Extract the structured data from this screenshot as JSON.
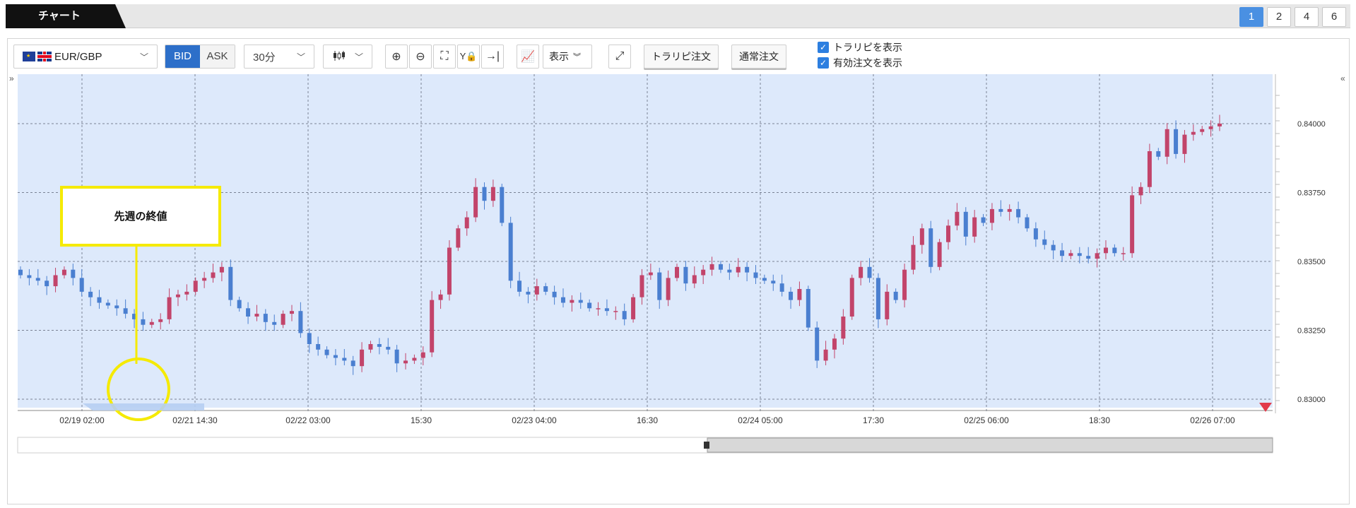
{
  "tabs": {
    "active_label": "チャート",
    "layout_buttons": [
      "1",
      "2",
      "4",
      "6"
    ],
    "active_layout": "1"
  },
  "toolbar": {
    "pair": "EUR/GBP",
    "bid": "BID",
    "ask": "ASK",
    "period": "30分",
    "display": "表示",
    "trailing_order": "トラリピ注文",
    "normal_order": "通常注文",
    "check_show_trap": "トラリピを表示",
    "check_show_active": "有効注文を表示",
    "collapse_left": "»",
    "collapse_right": "«"
  },
  "annotation": {
    "label": "先週の終値"
  },
  "colors": {
    "up": "#c2446a",
    "down": "#4a7fd0",
    "plot_bg": "#dde9fb",
    "accent": "#2d6fc9",
    "highlight": "#f5ea00",
    "marker": "#e23b4b"
  },
  "chart_data": {
    "type": "candlestick",
    "y_ticks": [
      "0.84000",
      "0.83750",
      "0.83500",
      "0.83250",
      "0.83000"
    ],
    "ylim": [
      0.83,
      0.84
    ],
    "x_ticks": [
      "02/19 02:00",
      "02/21 14:30",
      "02/22 03:00",
      "15:30",
      "02/23 04:00",
      "16:30",
      "02/24 05:00",
      "17:30",
      "02/25 06:00",
      "18:30",
      "02/26 07:00"
    ],
    "close_path": [
      0.8345,
      0.8344,
      0.8343,
      0.8341,
      0.8345,
      0.8347,
      0.8344,
      0.8339,
      0.8337,
      0.8335,
      0.8334,
      0.8333,
      0.8331,
      0.8329,
      0.8327,
      0.8328,
      0.8329,
      0.8337,
      0.8338,
      0.8339,
      0.8343,
      0.8344,
      0.8346,
      0.8348,
      0.8336,
      0.8333,
      0.833,
      0.8331,
      0.8328,
      0.8327,
      0.8331,
      0.8332,
      0.8324,
      0.832,
      0.8318,
      0.8316,
      0.8315,
      0.8314,
      0.8312,
      0.8318,
      0.832,
      0.8319,
      0.8318,
      0.8313,
      0.8314,
      0.8315,
      0.8317,
      0.8336,
      0.8338,
      0.8355,
      0.8362,
      0.8366,
      0.8377,
      0.8372,
      0.8377,
      0.8364,
      0.8343,
      0.8339,
      0.8338,
      0.8341,
      0.8339,
      0.8337,
      0.8335,
      0.8336,
      0.8335,
      0.8333,
      0.8333,
      0.8332,
      0.8332,
      0.8329,
      0.8337,
      0.8345,
      0.8346,
      0.8336,
      0.8344,
      0.8348,
      0.8342,
      0.8345,
      0.8347,
      0.8349,
      0.8347,
      0.8346,
      0.8348,
      0.8346,
      0.8344,
      0.8343,
      0.8342,
      0.8339,
      0.8336,
      0.834,
      0.8326,
      0.8314,
      0.8318,
      0.8322,
      0.833,
      0.8344,
      0.8348,
      0.8344,
      0.8329,
      0.8339,
      0.8336,
      0.8347,
      0.8356,
      0.8362,
      0.8348,
      0.8357,
      0.8363,
      0.8368,
      0.8359,
      0.8366,
      0.8364,
      0.8369,
      0.8368,
      0.8369,
      0.8366,
      0.8362,
      0.8358,
      0.8356,
      0.8354,
      0.8352,
      0.8353,
      0.8352,
      0.8351,
      0.8353,
      0.8355,
      0.8353,
      0.8353,
      0.8374,
      0.8377,
      0.839,
      0.8388,
      0.8398,
      0.8389,
      0.8396,
      0.8397,
      0.8398,
      0.8399,
      0.84
    ],
    "current_price_marker": "0.83000"
  }
}
